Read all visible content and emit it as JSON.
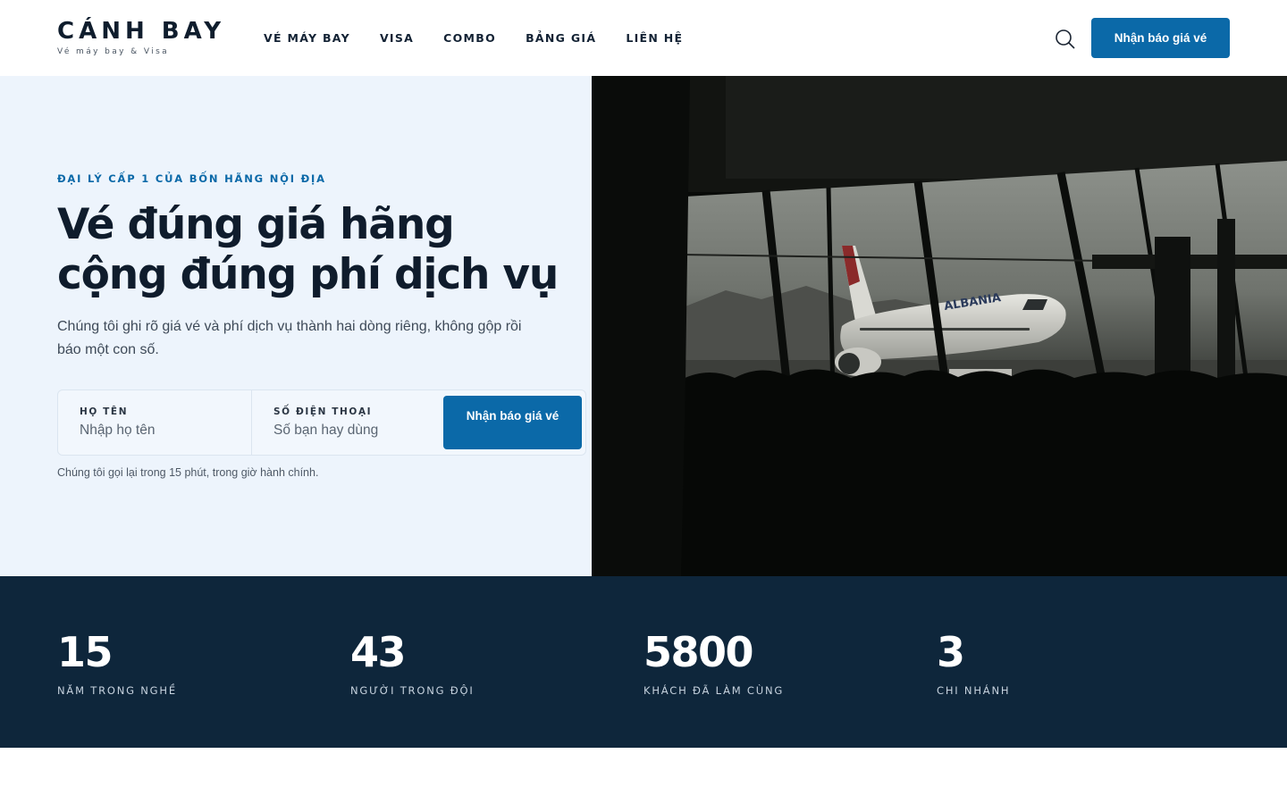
{
  "header": {
    "logo_title": "CÁNH BAY",
    "logo_subtitle": "Vé máy bay & Visa",
    "nav": [
      {
        "label": "VÉ MÁY BAY"
      },
      {
        "label": "VISA"
      },
      {
        "label": "COMBO"
      },
      {
        "label": "BẢNG GIÁ"
      },
      {
        "label": "LIÊN HỆ"
      }
    ],
    "search_icon": "search-icon",
    "cta_label": "Nhận báo giá vé"
  },
  "hero": {
    "eyebrow": "ĐẠI LÝ CẤP 1 CỦA BỐN HÃNG NỘI ĐỊA",
    "headline_line1": "Vé đúng giá hãng",
    "headline_line2": "cộng đúng phí dịch vụ",
    "subtext": "Chúng tôi ghi rõ giá vé và phí dịch vụ thành hai dòng riêng, không gộp rồi báo một con số.",
    "form": {
      "name_label": "HỌ TÊN",
      "name_placeholder": "Nhập họ tên",
      "name_value": "",
      "phone_label": "SỐ ĐIỆN THOẠI",
      "phone_placeholder": "Số bạn hay dùng",
      "phone_value": "",
      "submit_label": "Nhận báo giá vé",
      "note": "Chúng tôi gọi lại trong 15 phút, trong giờ hành chính."
    },
    "image": {
      "airline_text": "ALBANIA"
    }
  },
  "stats": [
    {
      "value": "15",
      "label": "NĂM TRONG NGHỀ"
    },
    {
      "value": "43",
      "label": "NGƯỜI TRONG ĐỘI"
    },
    {
      "value": "5800",
      "label": "KHÁCH ĐÃ LÀM CÙNG"
    },
    {
      "value": "3",
      "label": "CHI NHÁNH"
    }
  ],
  "colors": {
    "accent": "#0b69a8",
    "hero_bg": "#edf4fc",
    "stats_bg": "#0e263b",
    "text_dark": "#0f1c2c"
  }
}
